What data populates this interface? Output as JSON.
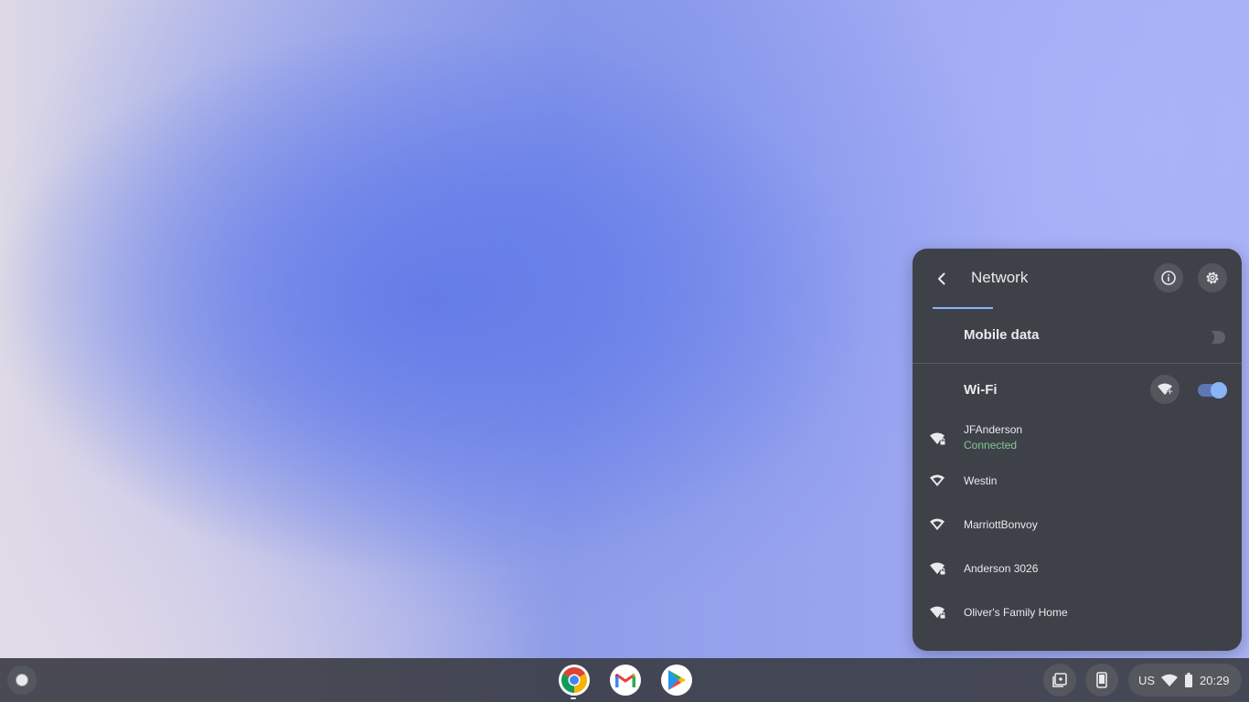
{
  "network_panel": {
    "title": "Network",
    "mobile_data": {
      "label": "Mobile data",
      "enabled": false
    },
    "wifi": {
      "label": "Wi-Fi",
      "enabled": true
    },
    "networks": [
      {
        "name": "JFAnderson",
        "status": "Connected",
        "secured": true
      },
      {
        "name": "Westin",
        "secured": false
      },
      {
        "name": "MarriottBonvoy",
        "secured": false
      },
      {
        "name": "Anderson 3026",
        "secured": true
      },
      {
        "name": "Oliver's Family Home",
        "secured": true
      }
    ],
    "colors": {
      "panel_bg": "#3f4149",
      "accent": "#8ab4f8",
      "connected": "#81c995"
    },
    "icons": {
      "back": "chevron-left-icon",
      "info": "info-icon",
      "settings": "gear-icon",
      "add_wifi": "add-wifi-icon"
    }
  },
  "shelf": {
    "apps": [
      "Chrome",
      "Gmail",
      "Play Store"
    ],
    "status": {
      "ime": "US",
      "time": "20:29"
    }
  }
}
